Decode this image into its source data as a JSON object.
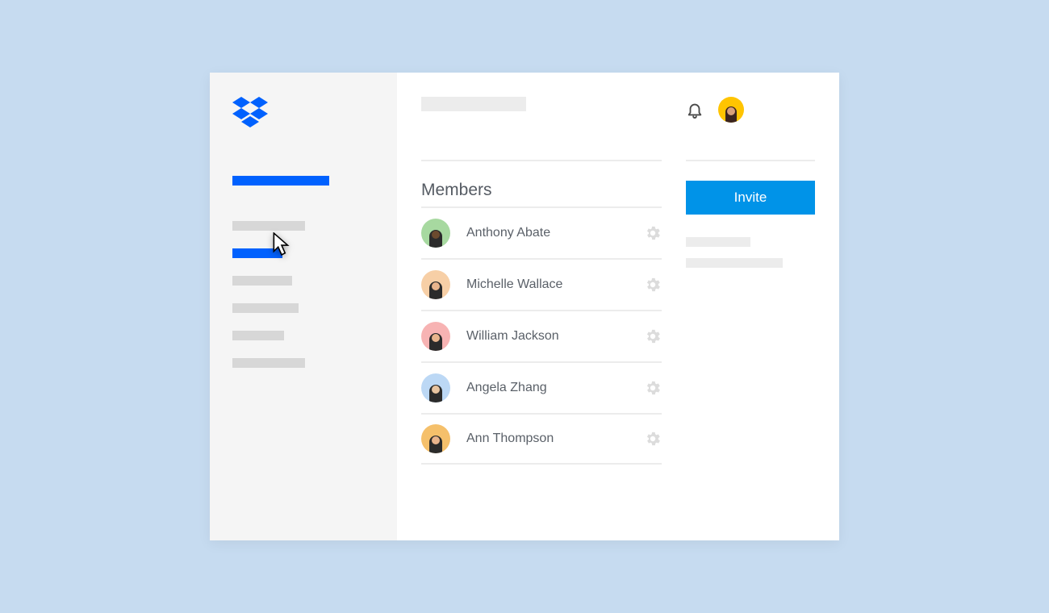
{
  "brand": "Dropbox",
  "section_title": "Members",
  "invite_button_label": "Invite",
  "colors": {
    "accent": "#0061fe",
    "button": "#0093e8",
    "page_bg": "#c6dbf0"
  },
  "members": [
    {
      "name": "Anthony Abate",
      "avatar_bg": "#a7d9a0",
      "skin": "#6b4a2e"
    },
    {
      "name": "Michelle Wallace",
      "avatar_bg": "#f7cfa6",
      "skin": "#e8b48c"
    },
    {
      "name": "William Jackson",
      "avatar_bg": "#f7b3b3",
      "skin": "#e8b48c"
    },
    {
      "name": "Angela Zhang",
      "avatar_bg": "#bcd8f5",
      "skin": "#e8c4a0"
    },
    {
      "name": "Ann Thompson",
      "avatar_bg": "#f5c06b",
      "skin": "#e8b48c"
    }
  ]
}
